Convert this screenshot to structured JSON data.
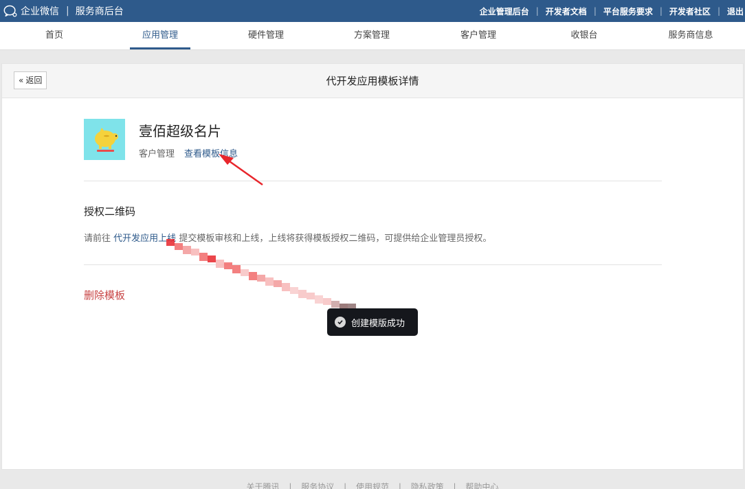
{
  "topbar": {
    "brand": "企业微信",
    "subtitle": "服务商后台",
    "links": [
      "企业管理后台",
      "开发者文档",
      "平台服务要求",
      "开发者社区",
      "退出"
    ]
  },
  "nav": {
    "items": [
      "首页",
      "应用管理",
      "硬件管理",
      "方案管理",
      "客户管理",
      "收银台",
      "服务商信息"
    ],
    "active": "应用管理"
  },
  "page": {
    "back_label": "返回",
    "title": "代开发应用模板详情"
  },
  "app": {
    "name": "壹佰超级名片",
    "category": "客户管理",
    "view_template_link": "查看模板信息"
  },
  "auth_section": {
    "title": "授权二维码",
    "desc_prefix": "请前往",
    "desc_link": "代开发应用上线",
    "desc_suffix": "提交模板审核和上线，上线将获得模板授权二维码，可提供给企业管理员授权。"
  },
  "delete_label": "删除模板",
  "toast": {
    "icon": "check-circle-icon",
    "text": "创建模版成功"
  },
  "footer": {
    "links": [
      "关于腾讯",
      "服务协议",
      "使用规范",
      "隐私政策",
      "帮助中心"
    ]
  },
  "colors": {
    "topbar": "#2e5a8b",
    "accent": "#2e5a8b",
    "danger": "#c74343",
    "annotation_arrow": "#e8262c"
  }
}
